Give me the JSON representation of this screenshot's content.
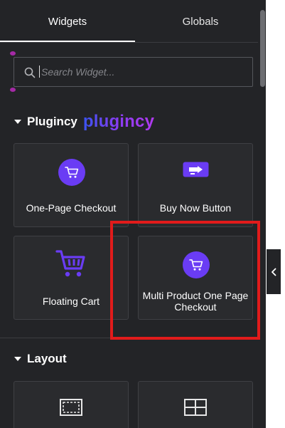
{
  "tabs": [
    {
      "label": "Widgets",
      "active": true
    },
    {
      "label": "Globals",
      "active": false
    }
  ],
  "search": {
    "placeholder": "Search Widget...",
    "value": ""
  },
  "sections": [
    {
      "title": "Plugincy",
      "brand_logo_text": "plugincy",
      "widgets": [
        {
          "label": "One-Page Checkout",
          "icon": "cart-icon"
        },
        {
          "label": "Buy Now Button",
          "icon": "buy-now-button-icon"
        },
        {
          "label": "Floating Cart",
          "icon": "shopping-cart-icon"
        },
        {
          "label": "Multi Product One Page Checkout",
          "icon": "cart-icon",
          "highlighted": true
        }
      ]
    },
    {
      "title": "Layout",
      "widgets": [
        {
          "label": "",
          "icon": "container-icon"
        },
        {
          "label": "",
          "icon": "grid-icon"
        }
      ]
    }
  ],
  "colors": {
    "panel_bg": "#232427",
    "card_bg": "#2a2b2e",
    "accent_purple": "#6a3cf4",
    "highlight_red": "#e11b1b"
  }
}
